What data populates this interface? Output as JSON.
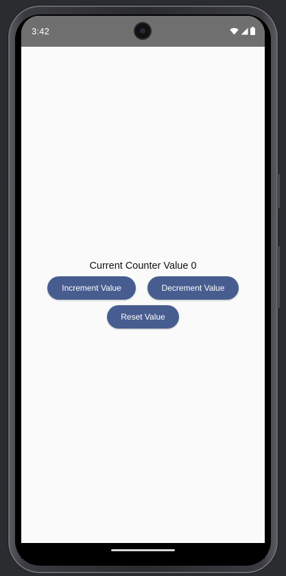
{
  "status_bar": {
    "time": "3:42",
    "icons": [
      "wifi-icon",
      "cellular-signal-icon",
      "battery-icon"
    ]
  },
  "main": {
    "counter_label": "Current Counter Value 0",
    "increment_label": "Increment Value",
    "decrement_label": "Decrement Value",
    "reset_label": "Reset Value"
  },
  "colors": {
    "button": "#485d8f",
    "status_bar": "#6f6f6f",
    "background": "#fafafa"
  }
}
